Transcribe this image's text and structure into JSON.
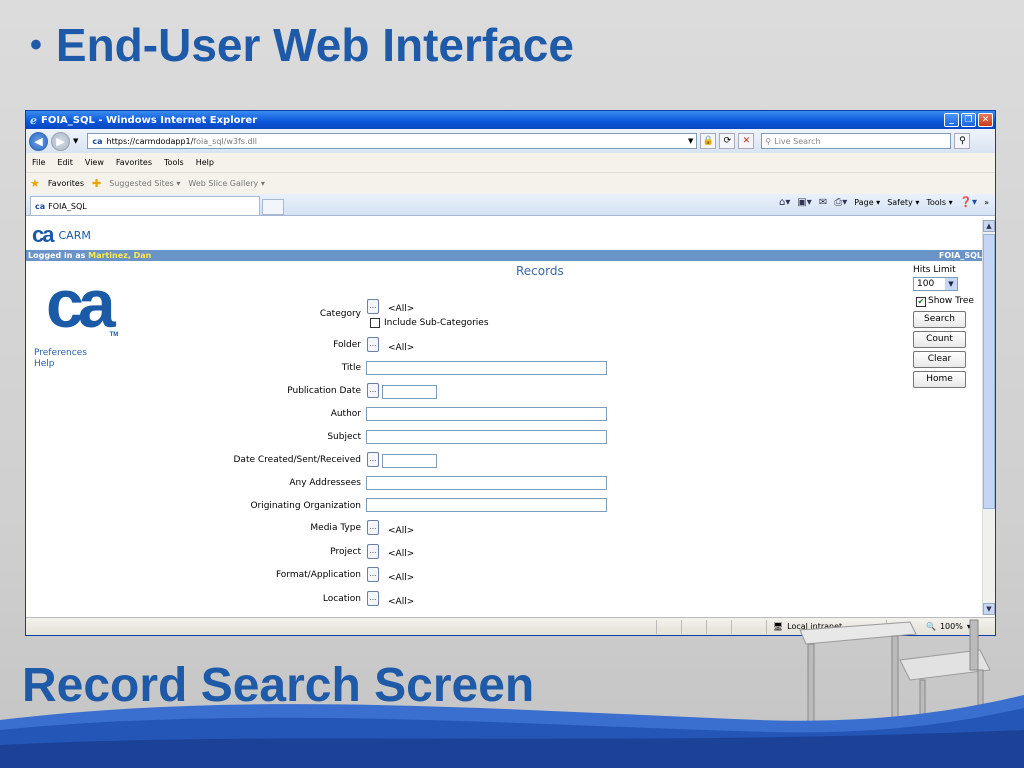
{
  "slide": {
    "bullet": "•",
    "title": "End-User Web Interface",
    "subtitle": "Record Search Screen"
  },
  "window": {
    "title": "FOIA_SQL - Windows Internet Explorer",
    "address_host": "https://carmdodapp1/",
    "address_path": "foia_sql/w3fs.dll",
    "live_search_placeholder": "Live Search",
    "minimize_glyph": "_",
    "restore_glyph": "❐",
    "close_glyph": "✕"
  },
  "menu": [
    "File",
    "Edit",
    "View",
    "Favorites",
    "Tools",
    "Help"
  ],
  "favorites": {
    "label": "Favorites",
    "suggested": "Suggested Sites ▾",
    "gallery": "Web Slice Gallery ▾"
  },
  "tab": {
    "label": "FOIA_SQL"
  },
  "commands": {
    "page": "Page ▾",
    "safety": "Safety ▾",
    "tools": "Tools ▾"
  },
  "app": {
    "logo_small": "ca",
    "name": "CARM",
    "logged_in_prefix": "Logged in as",
    "user": "Martinez, Dan",
    "db": "FOIA_SQL",
    "logo_big": "ca",
    "tm": "TM",
    "page_title": "Records",
    "links": [
      "Preferences",
      "Help"
    ]
  },
  "form": {
    "category": "Category",
    "category_value": "<All>",
    "include_sub": "Include Sub-Categories",
    "folder": "Folder",
    "folder_value": "<All>",
    "title": "Title",
    "publication_date": "Publication Date",
    "author": "Author",
    "subject": "Subject",
    "date_created": "Date Created/Sent/Received",
    "any_addressees": "Any Addressees",
    "originating_org": "Originating Organization",
    "media_type": "Media Type",
    "media_type_value": "<All>",
    "project": "Project",
    "project_value": "<All>",
    "format": "Format/Application",
    "format_value": "<All>",
    "location": "Location",
    "location_value": "<All>",
    "dots": "..."
  },
  "controls": {
    "hits_limit_label": "Hits Limit",
    "hits_limit_value": "100",
    "show_tree": "Show Tree",
    "search": "Search",
    "count": "Count",
    "clear": "Clear",
    "home": "Home"
  },
  "status": {
    "zone": "Local intranet",
    "zoom": "100%"
  },
  "colors": {
    "slide_blue": "#1f5aa8",
    "ie_blue": "#0a55d8",
    "login_bar": "#6a93c8",
    "user_yellow": "#ffe94d"
  }
}
